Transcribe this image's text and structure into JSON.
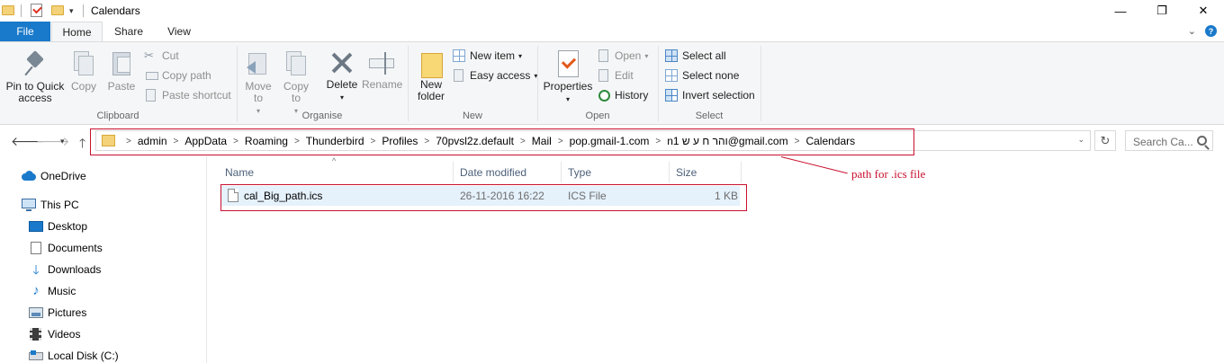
{
  "window": {
    "title": "Calendars",
    "controls": {
      "minimize": "—",
      "maximize": "❐",
      "close": "✕"
    }
  },
  "ribbon_tabs": {
    "file": "File",
    "home": "Home",
    "share": "Share",
    "view": "View"
  },
  "ribbon": {
    "clipboard": {
      "label": "Clipboard",
      "pin_to_quick_access": "Pin to Quick access",
      "copy": "Copy",
      "paste": "Paste",
      "cut": "Cut",
      "copy_path": "Copy path",
      "paste_shortcut": "Paste shortcut"
    },
    "organise": {
      "label": "Organise",
      "move_to": "Move to",
      "copy_to": "Copy to",
      "delete": "Delete",
      "rename": "Rename"
    },
    "new": {
      "label": "New",
      "new_folder": "New folder",
      "new_item": "New item",
      "easy_access": "Easy access"
    },
    "open": {
      "label": "Open",
      "properties": "Properties",
      "open": "Open",
      "edit": "Edit",
      "history": "History"
    },
    "select": {
      "label": "Select",
      "select_all": "Select all",
      "select_none": "Select none",
      "invert_selection": "Invert selection"
    }
  },
  "address": {
    "crumbs": [
      "admin",
      "AppData",
      "Roaming",
      "Thunderbird",
      "Profiles",
      "70pvsl2z.default",
      "Mail",
      "pop.gmail-1.com",
      "nוהר ח ע ש 1@gmail.com",
      "Calendars"
    ],
    "search_placeholder": "Search Ca..."
  },
  "nav_pane": {
    "items": [
      "OneDrive",
      "This PC",
      "Desktop",
      "Documents",
      "Downloads",
      "Music",
      "Pictures",
      "Videos",
      "Local Disk (C:)"
    ]
  },
  "file_list": {
    "columns": {
      "name": "Name",
      "date_modified": "Date modified",
      "type": "Type",
      "size": "Size"
    },
    "rows": [
      {
        "name": "cal_Big_path.ics",
        "date_modified": "26-11-2016 16:22",
        "type": "ICS File",
        "size": "1 KB"
      }
    ]
  },
  "annotation": {
    "text": "path for .ics file",
    "color": "#c8102e"
  },
  "colors": {
    "accent": "#1979ca",
    "selection": "#e5f1fb",
    "annotation": "#c8102e"
  }
}
